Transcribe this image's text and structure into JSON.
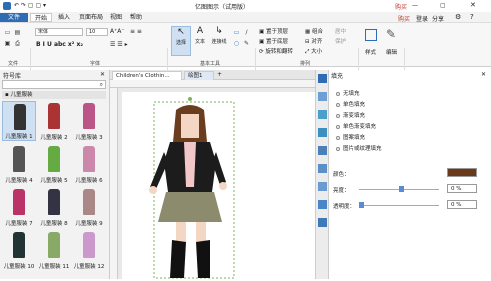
{
  "title": "亿图图示（试用版）",
  "window_right": {
    "buy": "购买",
    "login": "登录",
    "share": "分享"
  },
  "menus": [
    "文件",
    "开始",
    "插入",
    "页面布局",
    "视图",
    "帮助"
  ],
  "font": {
    "name": "宋体",
    "size": "10"
  },
  "ribbon_groups": [
    "文件",
    "字体",
    "基本工具",
    "排列"
  ],
  "tools": [
    "选择",
    "文本",
    "连接线"
  ],
  "arrange": [
    "置于顶层",
    "置于底层",
    "旋转和翻转",
    "组合",
    "对齐",
    "大小",
    "居中",
    "保护"
  ],
  "style_labels": [
    "样式",
    "编辑"
  ],
  "lib": {
    "title": "符号库",
    "category": "儿童服装",
    "items": [
      "儿童服装 1",
      "儿童服装 2",
      "儿童服装 3",
      "儿童服装 4",
      "儿童服装 5",
      "儿童服装 6",
      "儿童服装 7",
      "儿童服装 8",
      "儿童服装 9",
      "儿童服装 10",
      "儿童服装 11",
      "儿童服装 12"
    ]
  },
  "tabs": [
    "Children's Clothin...",
    "绘图1"
  ],
  "fill": {
    "title": "填充",
    "options": [
      "无填充",
      "单色填充",
      "渐变填充",
      "单色渐变填充",
      "图案填充",
      "图片或纹理填充"
    ],
    "color_label": "颜色：",
    "brightness_label": "亮度：",
    "brightness_val": "0 %",
    "transparency_label": "透明度：",
    "transparency_val": "0 %"
  },
  "colors": {
    "accent": "#2e6db4",
    "fill_swatch": "#6b3a1a"
  }
}
